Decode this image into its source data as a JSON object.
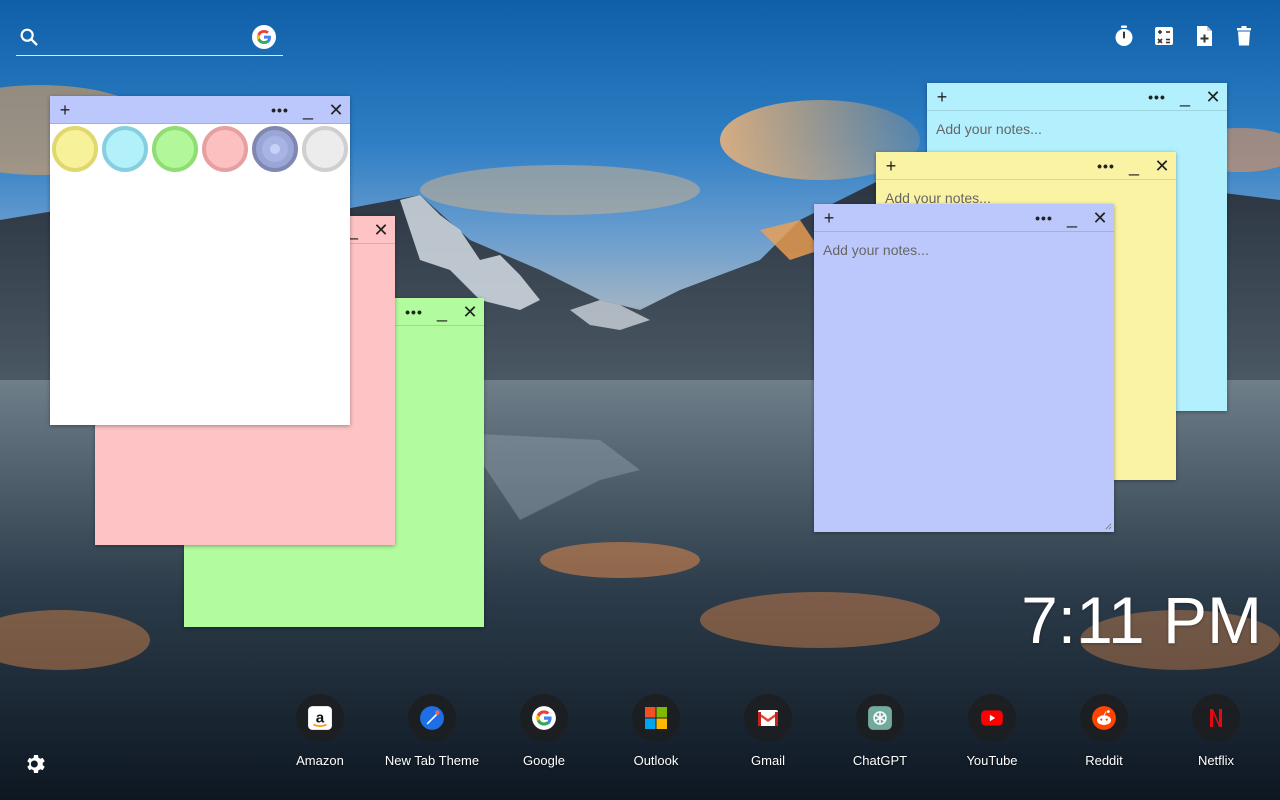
{
  "search": {
    "placeholder": "",
    "value": ""
  },
  "top_tools": [
    {
      "icon": "timer-icon"
    },
    {
      "icon": "calculator-icon"
    },
    {
      "icon": "add-note-icon"
    },
    {
      "icon": "trash-icon"
    }
  ],
  "notes": {
    "palette": {
      "colors": [
        "#f7f29a",
        "#b2f0fa",
        "#b2f79a",
        "#fcc0c0",
        "#9aa6d6",
        "#ececec"
      ]
    },
    "blue_right": {
      "placeholder": "Add your notes...",
      "color": "#bcc8fb"
    },
    "yellow_right": {
      "placeholder": "Add your notes...",
      "color": "#fbf3a4"
    },
    "cyan_right": {
      "placeholder": "Add your notes...",
      "color": "#b2f0fd"
    },
    "pink_left": {
      "color": "#fec3c4"
    },
    "green_left": {
      "color": "#b2fb9e"
    }
  },
  "clock": {
    "time": "7:11 PM"
  },
  "shortcuts": [
    {
      "label": "Amazon",
      "icon": "amazon-icon"
    },
    {
      "label": "New Tab Theme",
      "icon": "new-tab-theme-icon"
    },
    {
      "label": "Google",
      "icon": "google-icon"
    },
    {
      "label": "Outlook",
      "icon": "outlook-icon"
    },
    {
      "label": "Gmail",
      "icon": "gmail-icon"
    },
    {
      "label": "ChatGPT",
      "icon": "chatgpt-icon"
    },
    {
      "label": "YouTube",
      "icon": "youtube-icon"
    },
    {
      "label": "Reddit",
      "icon": "reddit-icon"
    },
    {
      "label": "Netflix",
      "icon": "netflix-icon"
    }
  ]
}
